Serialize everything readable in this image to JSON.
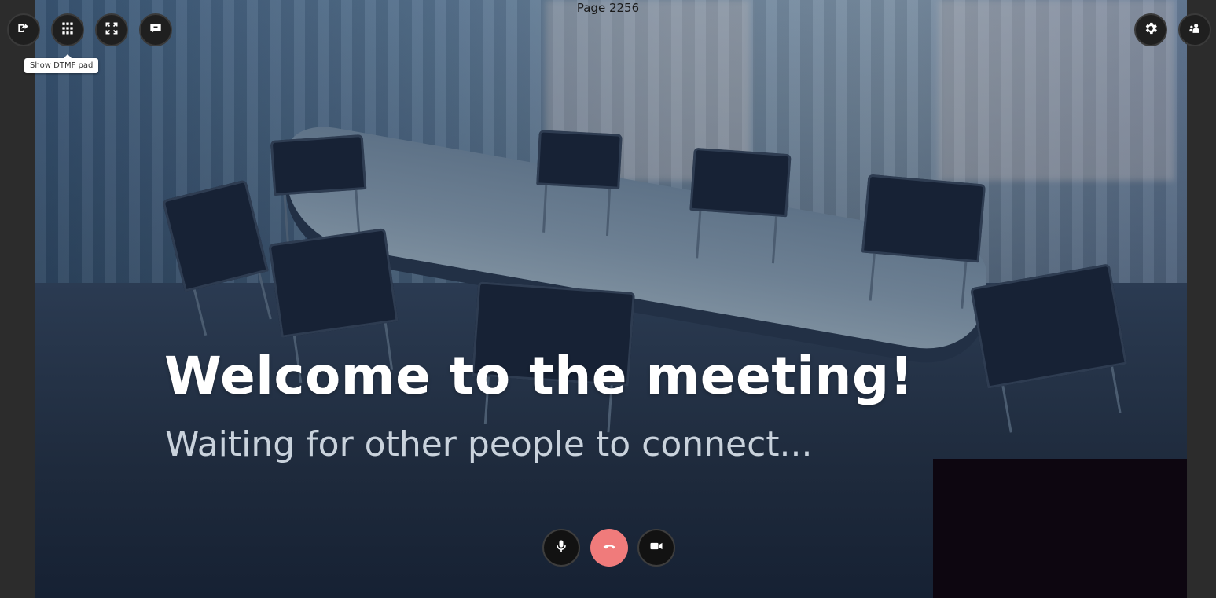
{
  "page": {
    "label": "Page 2256"
  },
  "toolbar_left": {
    "buttons": [
      {
        "name": "share-screen",
        "icon": "share-screen-icon"
      },
      {
        "name": "dtmf-pad",
        "icon": "dialpad-icon"
      },
      {
        "name": "fullscreen",
        "icon": "fullscreen-icon"
      },
      {
        "name": "chat",
        "icon": "chat-icon"
      }
    ],
    "tooltip": "Show DTMF pad"
  },
  "toolbar_right": {
    "buttons": [
      {
        "name": "settings",
        "icon": "gear-icon"
      },
      {
        "name": "participants",
        "icon": "participants-icon"
      }
    ]
  },
  "overlay": {
    "title": "Welcome to the meeting!",
    "subtitle": "Waiting for other people to connect..."
  },
  "call_controls": [
    {
      "name": "microphone",
      "icon": "microphone-icon"
    },
    {
      "name": "hang-up",
      "icon": "hang-up-icon",
      "color": "#f07b7b"
    },
    {
      "name": "camera",
      "icon": "video-camera-icon"
    }
  ]
}
